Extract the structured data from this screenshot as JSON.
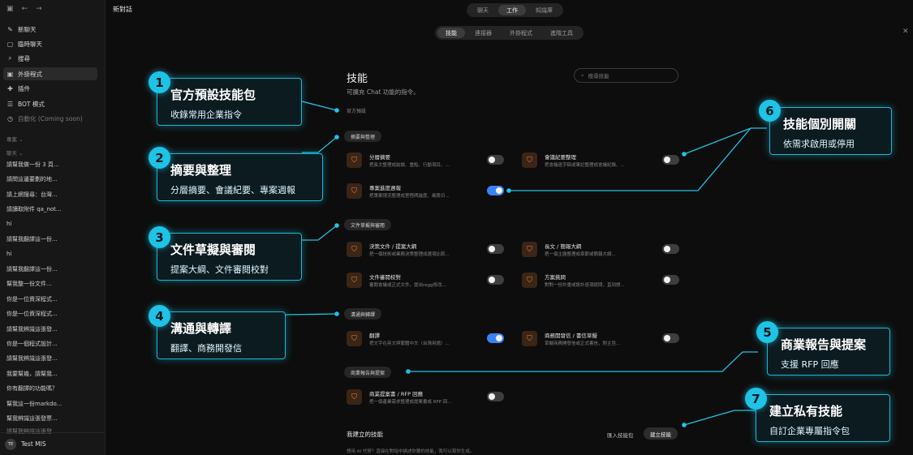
{
  "sidebar": {
    "items": [
      {
        "label": "新聊天",
        "icon": "✎"
      },
      {
        "label": "臨時聊天",
        "icon": "▢"
      },
      {
        "label": "搜尋",
        "icon": "⌕"
      },
      {
        "label": "外掛程式",
        "icon": "▣"
      },
      {
        "label": "插件",
        "icon": "✚"
      },
      {
        "label": "BOT 模式",
        "icon": "☰"
      },
      {
        "label": "自動化 (Coming soon)",
        "icon": "◷"
      }
    ],
    "section_projects": "專案 ⌄",
    "section_chats": "聊天 ⌄",
    "history": [
      "請幫我做一份 3 頁...",
      "請問這邊要劃的地...",
      "請上網搜尋：台灣...",
      "請讀取附件 qa_not...",
      "hi",
      "請幫我翻譯這一份...",
      "hi",
      "請幫我翻譯這一份...",
      "幫我整一份文件...",
      "你是一位資深程式...",
      "你是一位資深程式...",
      "請幫我辨識這張發...",
      "你是一個程式設計...",
      "請幫我辨識這張發...",
      "我要幫幾，請幫我...",
      "你有翻譯的功能嗎？",
      "幫我這一份markdo...",
      "幫我辨識這張發票...",
      "請幫我辨識這張發..."
    ],
    "user": {
      "initials": "TE",
      "name": "Test MIS"
    }
  },
  "header": {
    "title": "新對話",
    "modes": [
      "聊天",
      "工作",
      "知識庫"
    ],
    "tabs": [
      "技能",
      "連接器",
      "外掛程式",
      "進階工具"
    ]
  },
  "skills": {
    "heading": "技能",
    "description": "可擴充 Chat 功能的指令。",
    "search_placeholder": "搜尋技能",
    "official_label": "官方預設",
    "categories": [
      {
        "name": "摘要與整理",
        "skills": [
          {
            "name": "分層摘要",
            "desc": "把長文整理成結論、重點、行動項目、...",
            "on": false
          },
          {
            "name": "會議紀要整理",
            "desc": "把會議逐字稿或筆記整理成會議紀錄、...",
            "on": false
          },
          {
            "name": "專案進度週報",
            "desc": "把專案現況整理成里程碑進度、風險日...",
            "on": true
          }
        ]
      },
      {
        "name": "文件草擬與審閱",
        "skills": [
          {
            "name": "決策文件 / 提案大綱",
            "desc": "把一個技術或業務決策整理成選項比較...",
            "on": false
          },
          {
            "name": "長文 / 簡報大綱",
            "desc": "把一個主題整理成章節或簡報大綱...",
            "on": false
          },
          {
            "name": "文件審閱校對",
            "desc": "審閱會議或正式文件，提出regg修改...",
            "on": false
          },
          {
            "name": "方案挑問",
            "desc": "對對一份計畫或設計逐項提問，直到想...",
            "on": false
          }
        ]
      },
      {
        "name": "溝通與轉譯",
        "skills": [
          {
            "name": "翻譯",
            "desc": "把文字在英文與繁體中文（台灣用語）...",
            "on": true
          },
          {
            "name": "商務開發信 / 書信草擬",
            "desc": "草擬商務開發信或正式書信，附主旨...",
            "on": false
          }
        ]
      },
      {
        "name": "商業報告與提案",
        "skills": [
          {
            "name": "商業提案書 / RFP 回應",
            "desc": "把一個產業需求整理成提案書或 RFP 回...",
            "on": false
          }
        ]
      }
    ],
    "my_skills_title": "我建立的技能",
    "import_label": "匯入技能包",
    "create_label": "建立技能",
    "my_skills_desc": "想用 AI 代勞？直接在對話中描述你要的技能，我可以幫你生成。"
  },
  "callouts": [
    {
      "num": "1",
      "title": "官方預設技能包",
      "sub": "收錄常用企業指令"
    },
    {
      "num": "2",
      "title": "摘要與整理",
      "sub": "分層摘要、會議紀要、專案週報"
    },
    {
      "num": "3",
      "title": "文件草擬與審閱",
      "sub": "提案大綱、文件審閱校對"
    },
    {
      "num": "4",
      "title": "溝通與轉譯",
      "sub": "翻譯、商務開發信"
    },
    {
      "num": "5",
      "title": "商業報告與提案",
      "sub": "支援 RFP 回應"
    },
    {
      "num": "6",
      "title": "技能個別開關",
      "sub": "依需求啟用或停用"
    },
    {
      "num": "7",
      "title": "建立私有技能",
      "sub": "自訂企業專屬指令包"
    }
  ],
  "colors": {
    "accent": "#1ec3e6",
    "toggle_on": "#3b82f6",
    "skill_icon": "#ef8a3d"
  },
  "icons": {
    "search": "search-icon",
    "skill": "shield-icon",
    "close": "close-icon"
  }
}
